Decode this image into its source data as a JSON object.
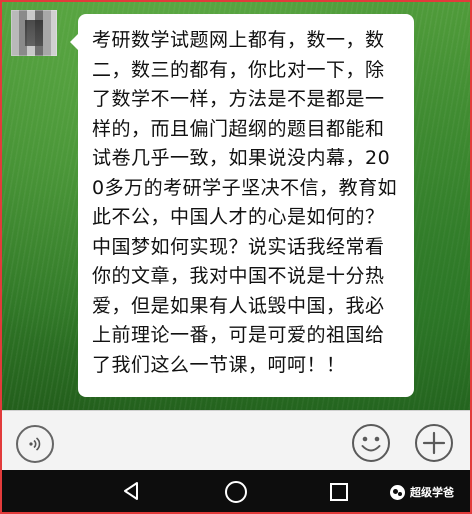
{
  "message": {
    "text": "考研数学试题网上都有，数一，数二，数三的都有，你比对一下，除了数学不一样，方法是不是都是一样的，而且偏门超纲的题目都能和试卷几乎一致，如果说没内幕，200多万的考研学子坚决不信，教育如此不公，中国人才的心是如何的？中国梦如何实现？说实话我经常看你的文章，我对中国不说是十分热爱，但是如果有人诋毁中国，我必上前理论一番，可是可爱的祖国给了我们这么一节课，呵呵！！"
  },
  "input_bar": {
    "voice_icon": "voice-icon",
    "emoji_icon": "emoji-icon",
    "plus_icon": "plus-icon"
  },
  "nav_bar": {
    "back_icon": "back-icon",
    "home_icon": "home-icon",
    "recent_icon": "recent-apps-icon"
  },
  "watermark": {
    "text": "超级学爸"
  },
  "colors": {
    "frame_border": "#e23b3b",
    "bubble": "#ffffff",
    "input_bar": "#f3f3f3",
    "nav_bar": "#0d0d0d",
    "chat_background": "#3f8a30"
  }
}
